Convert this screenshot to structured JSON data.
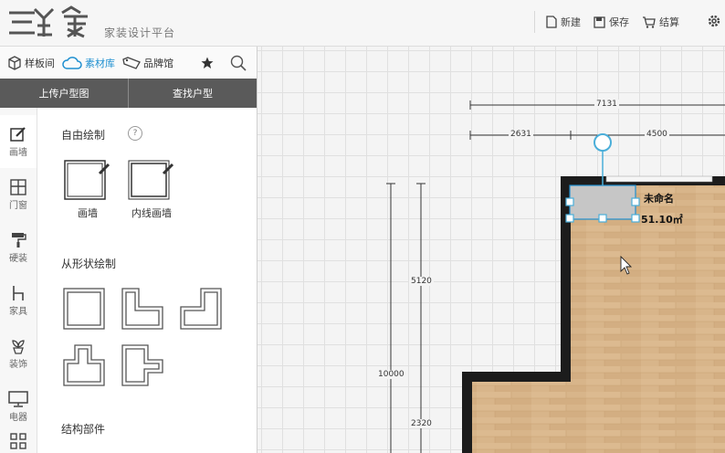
{
  "app": {
    "logo_text": "三维家",
    "slogan": "家装设计平台"
  },
  "toolbar": {
    "new_label": "新建",
    "save_label": "保存",
    "checkout_label": "结算"
  },
  "tabs": [
    {
      "label": "样板间",
      "icon": "box-icon"
    },
    {
      "label": "素材库",
      "icon": "cloud-icon"
    },
    {
      "label": "品牌馆",
      "icon": "tag-icon"
    }
  ],
  "actions": {
    "upload_label": "上传户型图",
    "find_label": "查找户型"
  },
  "categories": [
    {
      "label": "画墙",
      "icon": "pencil-icon"
    },
    {
      "label": "门窗",
      "icon": "window-icon"
    },
    {
      "label": "硬装",
      "icon": "paint-roller-icon"
    },
    {
      "label": "家具",
      "icon": "chair-icon"
    },
    {
      "label": "装饰",
      "icon": "plant-icon"
    },
    {
      "label": "电器",
      "icon": "monitor-icon"
    }
  ],
  "panel": {
    "free_draw_title": "自由绘制",
    "help": "?",
    "draw_wall": "画墙",
    "inner_wall": "内线画墙",
    "shape_title": "从形状绘制",
    "structure_title": "结构部件"
  },
  "canvas": {
    "dims": {
      "total_width": "7131",
      "seg_left": "2631",
      "seg_right": "4500",
      "total_height": "10000",
      "seg_upper": "5120",
      "seg_lower": "2320"
    },
    "room": {
      "name": "未命名",
      "area": "51.10㎡"
    }
  },
  "colors": {
    "accent": "#1e8fd0",
    "dark_bar": "#5a5a5a",
    "wall": "#1c1c1c",
    "floor": "#d8b58a"
  }
}
